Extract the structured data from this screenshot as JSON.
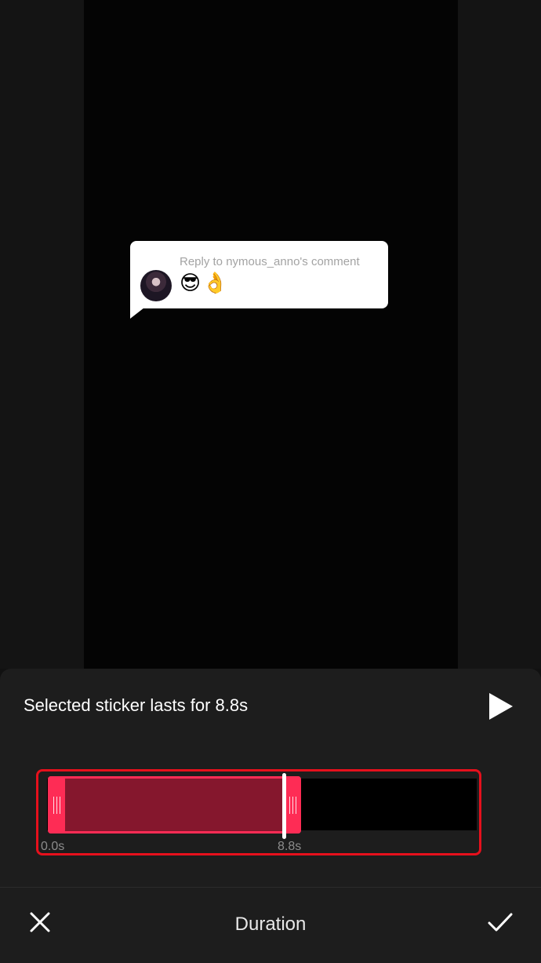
{
  "sticker": {
    "reply_title": "Reply to nymous_anno's comment",
    "emoji": "😎👌"
  },
  "panel": {
    "heading": "Selected sticker lasts for 8.8s",
    "play_icon": "play-icon"
  },
  "timeline": {
    "total_duration_s": 14.9,
    "range_start_s": 0.0,
    "range_end_s": 8.8,
    "start_label": "0.0s",
    "end_label": "8.8s",
    "accent_color": "#fe2c55",
    "frame_highlight_color": "#e6101c"
  },
  "footer": {
    "title": "Duration",
    "close_icon": "close-icon",
    "confirm_icon": "checkmark-icon"
  }
}
